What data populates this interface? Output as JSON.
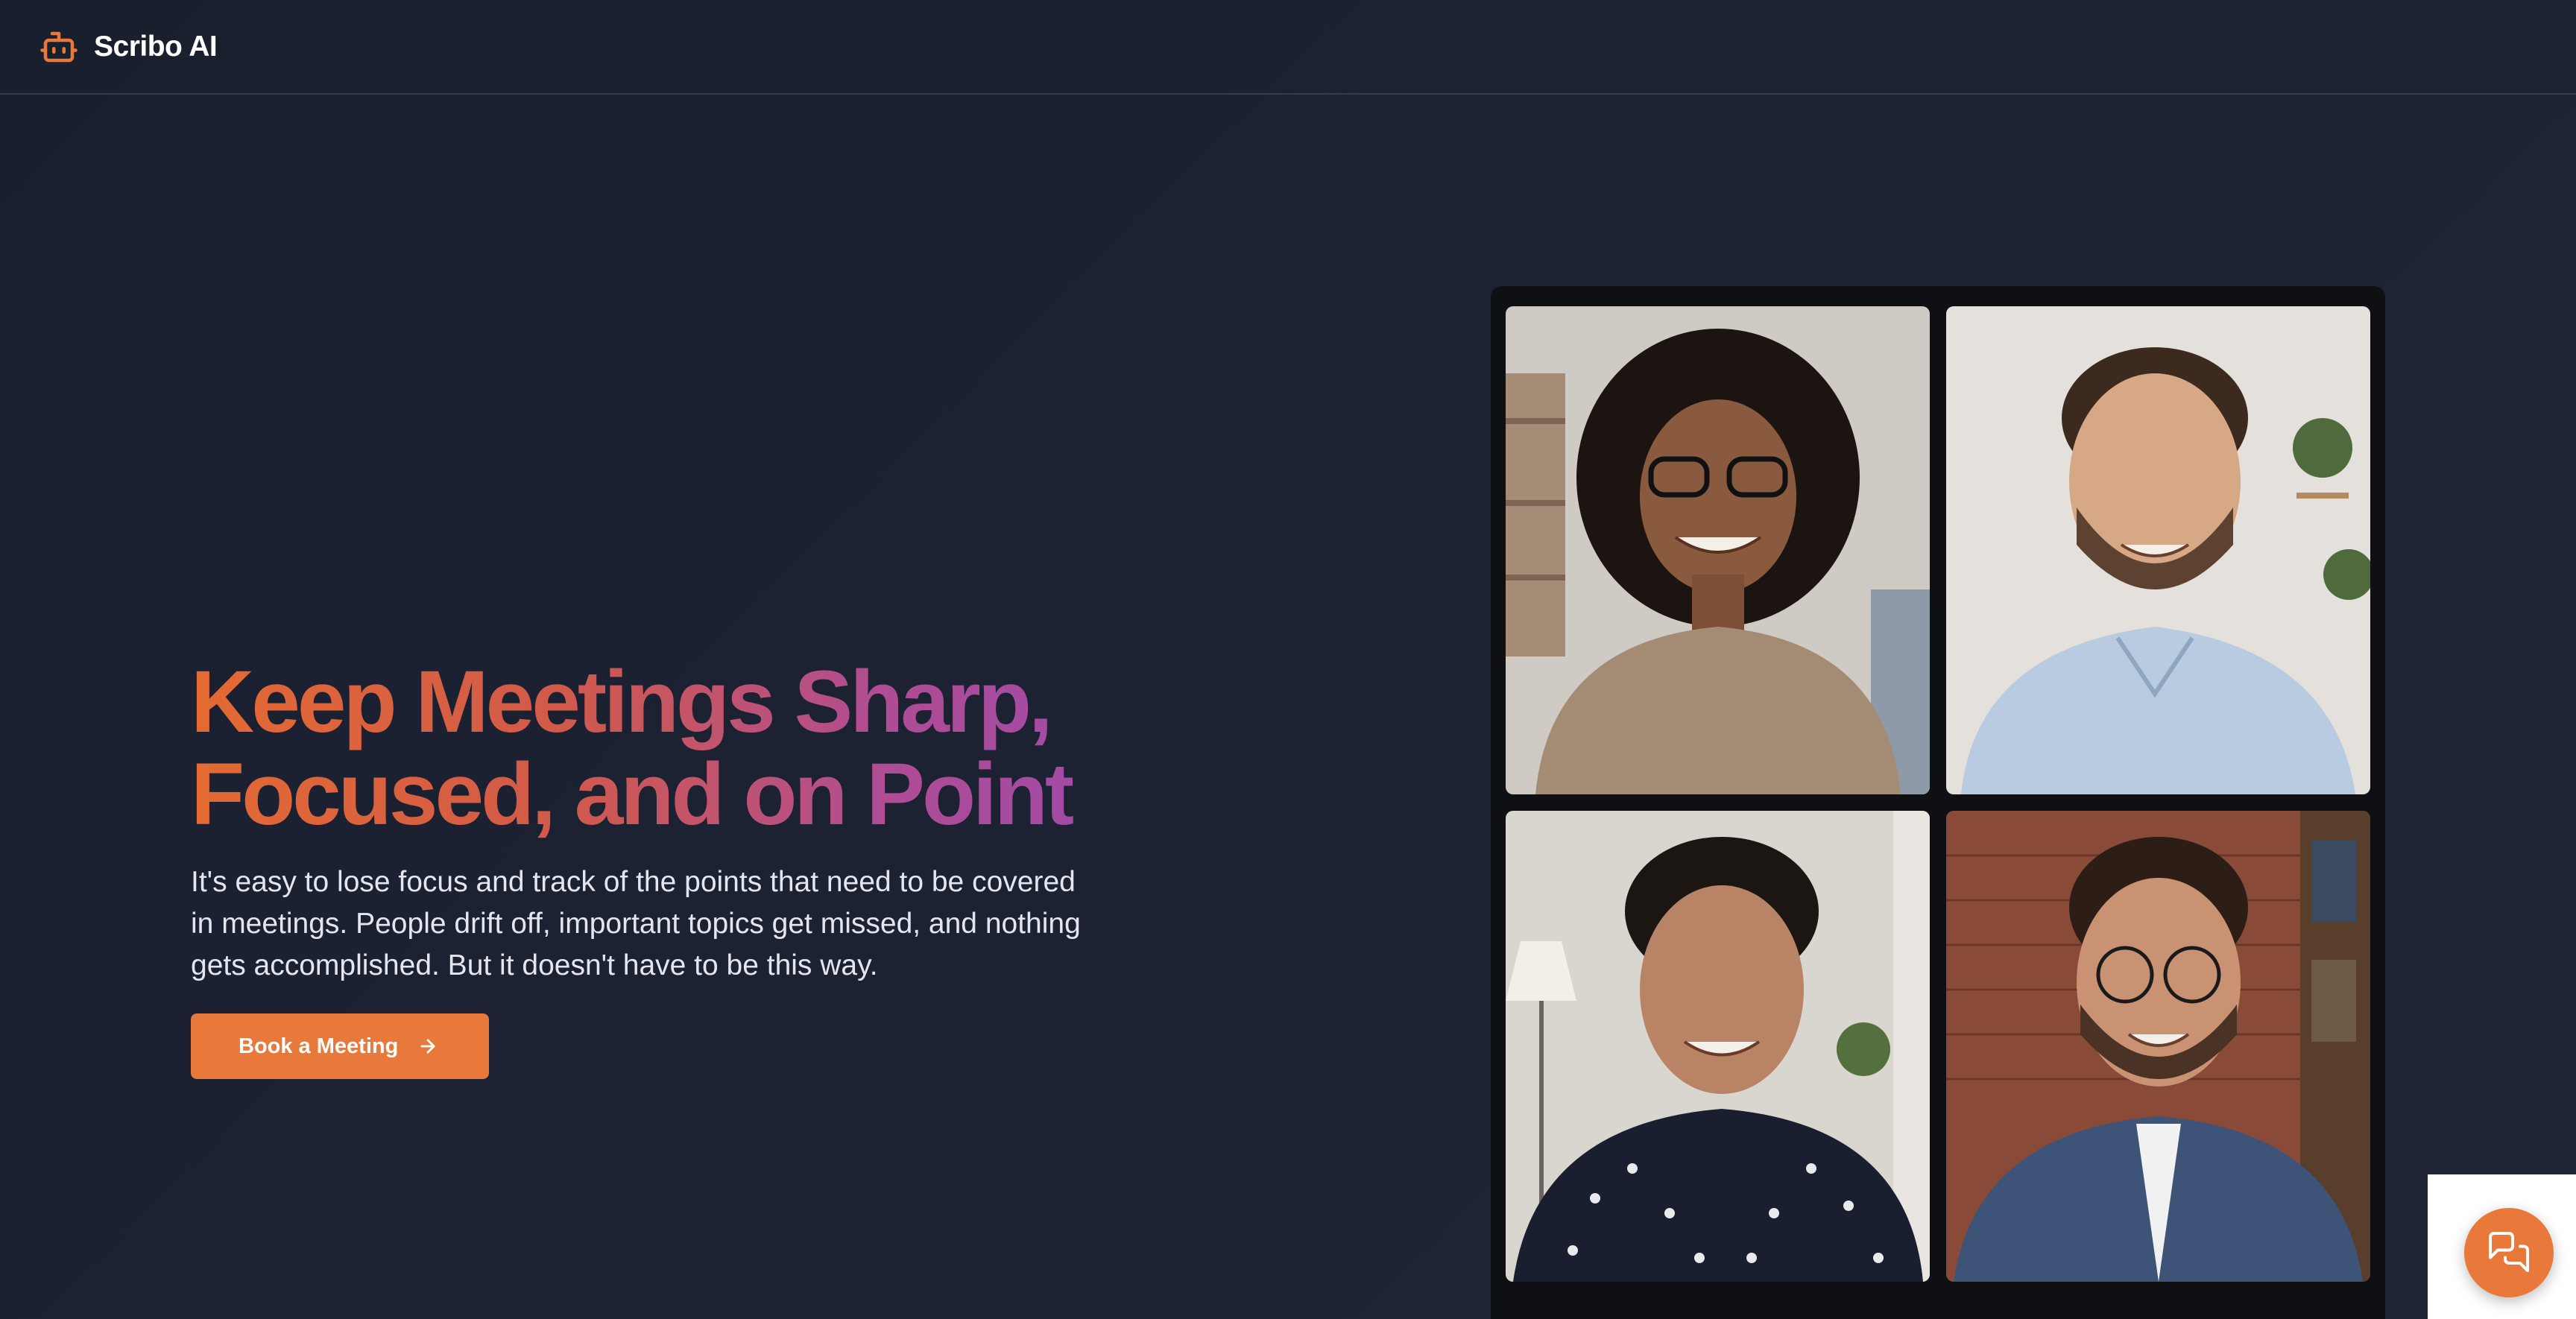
{
  "navbar": {
    "logo_icon": "robot-icon",
    "brand": "Scribo AI"
  },
  "hero": {
    "headline_line1": "Keep Meetings Sharp,",
    "headline_line2": "Focused, and on Point",
    "body": "It's easy to lose focus and track of the points that need to be covered in meetings. People drift off, important topics get missed, and nothing gets accomplished. But it doesn't have to be this way.",
    "cta_label": "Book a Meeting",
    "cta_icon": "arrow-right-icon"
  },
  "video_grid": {
    "tiles": [
      {
        "name": "participant-woman-curly-hair"
      },
      {
        "name": "participant-man-light-shirt"
      },
      {
        "name": "participant-woman-polka-dot"
      },
      {
        "name": "participant-man-glasses-denim"
      }
    ]
  },
  "chat_widget": {
    "icon": "chat-bubbles-icon"
  },
  "colors": {
    "accent": "#e8793a",
    "background": "#1c2232",
    "gradient_start": "#e46a32",
    "gradient_end": "#a04aa8"
  }
}
